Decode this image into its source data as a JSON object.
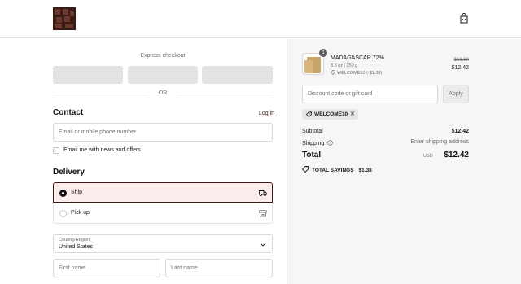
{
  "header": {
    "logo_icon": "brand-logo",
    "cart_icon": "shopping-bag-icon"
  },
  "express": {
    "label": "Express checkout",
    "buttons": [
      "",
      "",
      ""
    ],
    "or_text": "OR"
  },
  "contact": {
    "title": "Contact",
    "login_link": "Log in",
    "email_placeholder": "Email or mobile phone number",
    "newsletter_label": "Email me with news and offers"
  },
  "delivery": {
    "title": "Delivery",
    "options": [
      {
        "label": "Ship",
        "selected": true,
        "icon": "truck-icon"
      },
      {
        "label": "Pick up",
        "selected": false,
        "icon": "store-icon"
      }
    ],
    "country_label": "Country/Region",
    "country_value": "United States",
    "first_name_placeholder": "First name",
    "last_name_placeholder": "Last name"
  },
  "summary": {
    "item": {
      "quantity": "1",
      "name": "MADAGASCAR 72%",
      "variant": "8.8 oz | 250 g",
      "discount": "WELCOME10 (-$1.38)",
      "original_price": "$13.80",
      "price": "$12.42"
    },
    "discount_placeholder": "Discount code or gift card",
    "apply_label": "Apply",
    "applied_code": "WELCOME10",
    "subtotal_label": "Subtotal",
    "subtotal_value": "$12.42",
    "shipping_label": "Shipping",
    "shipping_value": "Enter shipping address",
    "total_label": "Total",
    "total_currency": "USD",
    "total_value": "$12.42",
    "savings_label": "TOTAL SAVINGS",
    "savings_value": "$1.38"
  },
  "colors": {
    "brand": "#3b1a14",
    "selected_bg": "#fbecec",
    "sidebar_bg": "#f6f6f6"
  }
}
